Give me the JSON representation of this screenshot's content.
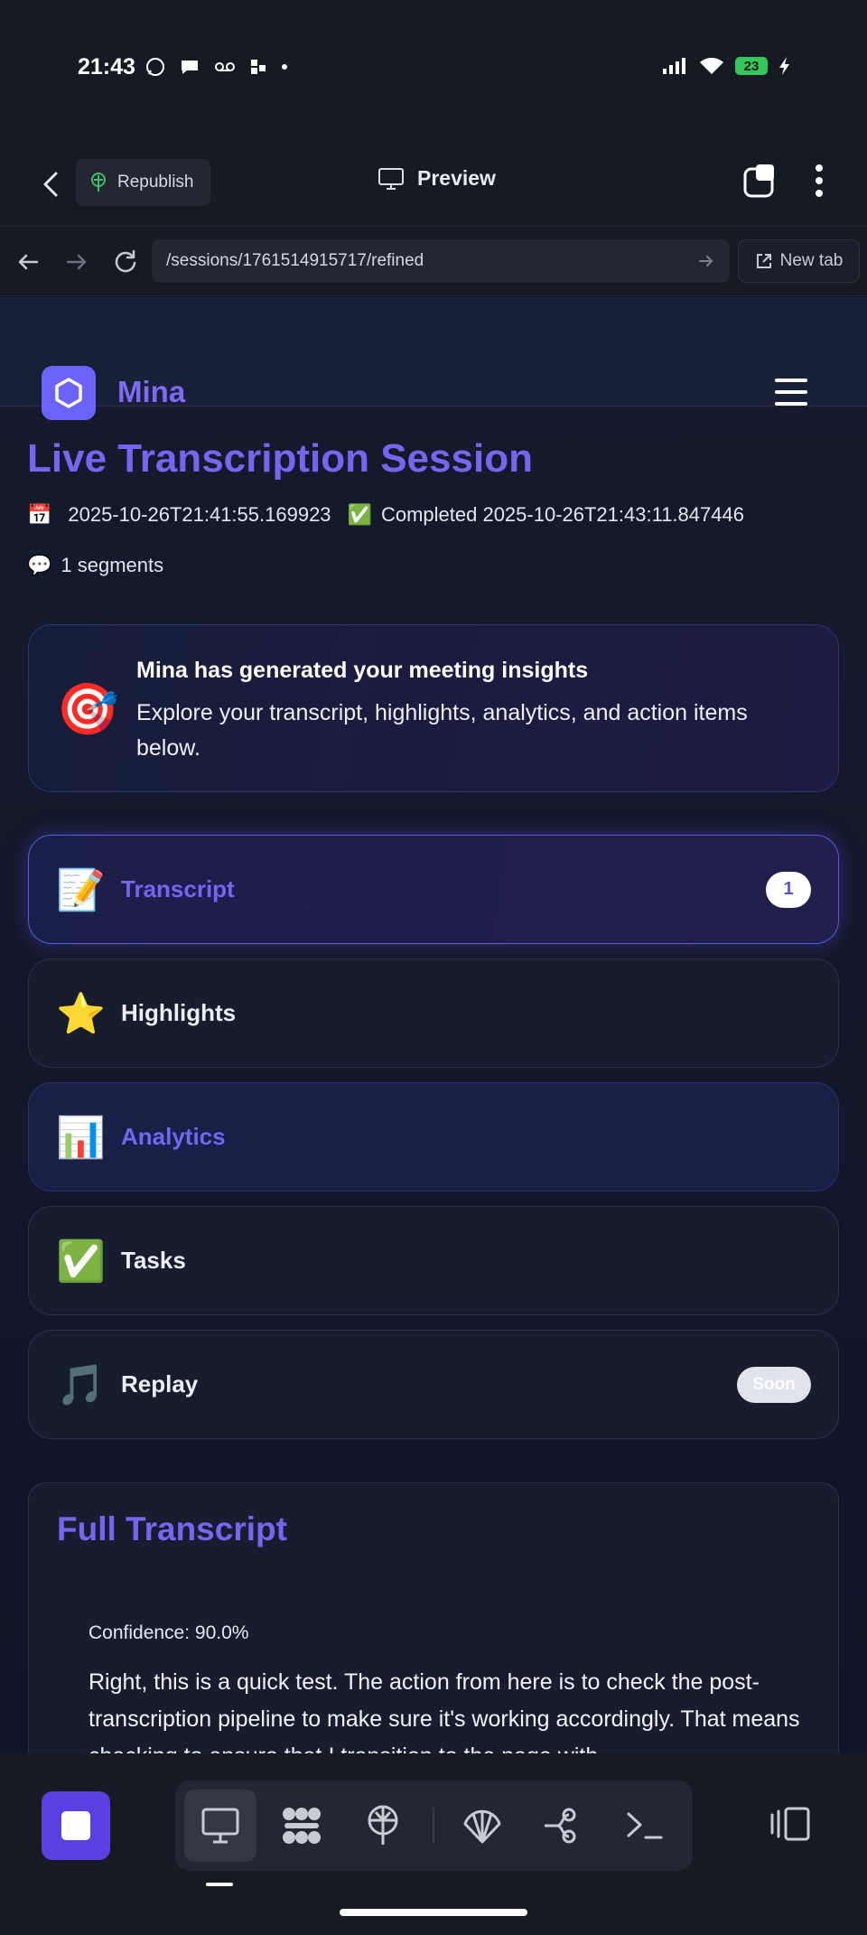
{
  "status": {
    "time": "21:43",
    "battery": "23"
  },
  "toolbar": {
    "republish_label": "Republish",
    "preview_label": "Preview"
  },
  "address": {
    "url": "/sessions/1761514915717/refined",
    "new_tab_label": "New tab"
  },
  "app": {
    "brand": "Mina"
  },
  "session": {
    "title": "Live Transcription Session",
    "started_icon": "📅",
    "started": "2025-10-26T21:41:55.169923",
    "completed_icon": "✅",
    "completed": "Completed 2025-10-26T21:43:11.847446",
    "segments_icon": "💬",
    "segments": "1 segments"
  },
  "insight": {
    "icon": "🎯",
    "title": "Mina has generated your meeting insights",
    "text": "Explore your transcript, highlights, analytics, and action items below."
  },
  "tabs": [
    {
      "emoji": "📝",
      "label": "Transcript",
      "badge": "1"
    },
    {
      "emoji": "⭐",
      "label": "Highlights"
    },
    {
      "emoji": "📊",
      "label": "Analytics"
    },
    {
      "emoji": "✅",
      "label": "Tasks"
    },
    {
      "emoji": "🎵",
      "label": "Replay",
      "badge": "Soon"
    }
  ],
  "transcript": {
    "title": "Full Transcript",
    "confidence": "Confidence: 90.0%",
    "text": "Right, this is a quick test. The action from here is to check the post-transcription pipeline to make sure it's working accordingly. That means checking to ensure that I transition to the page with"
  },
  "colors": {
    "accent": "#7366f0",
    "background": "#0f1424",
    "stop_button": "#5b3fe0"
  }
}
